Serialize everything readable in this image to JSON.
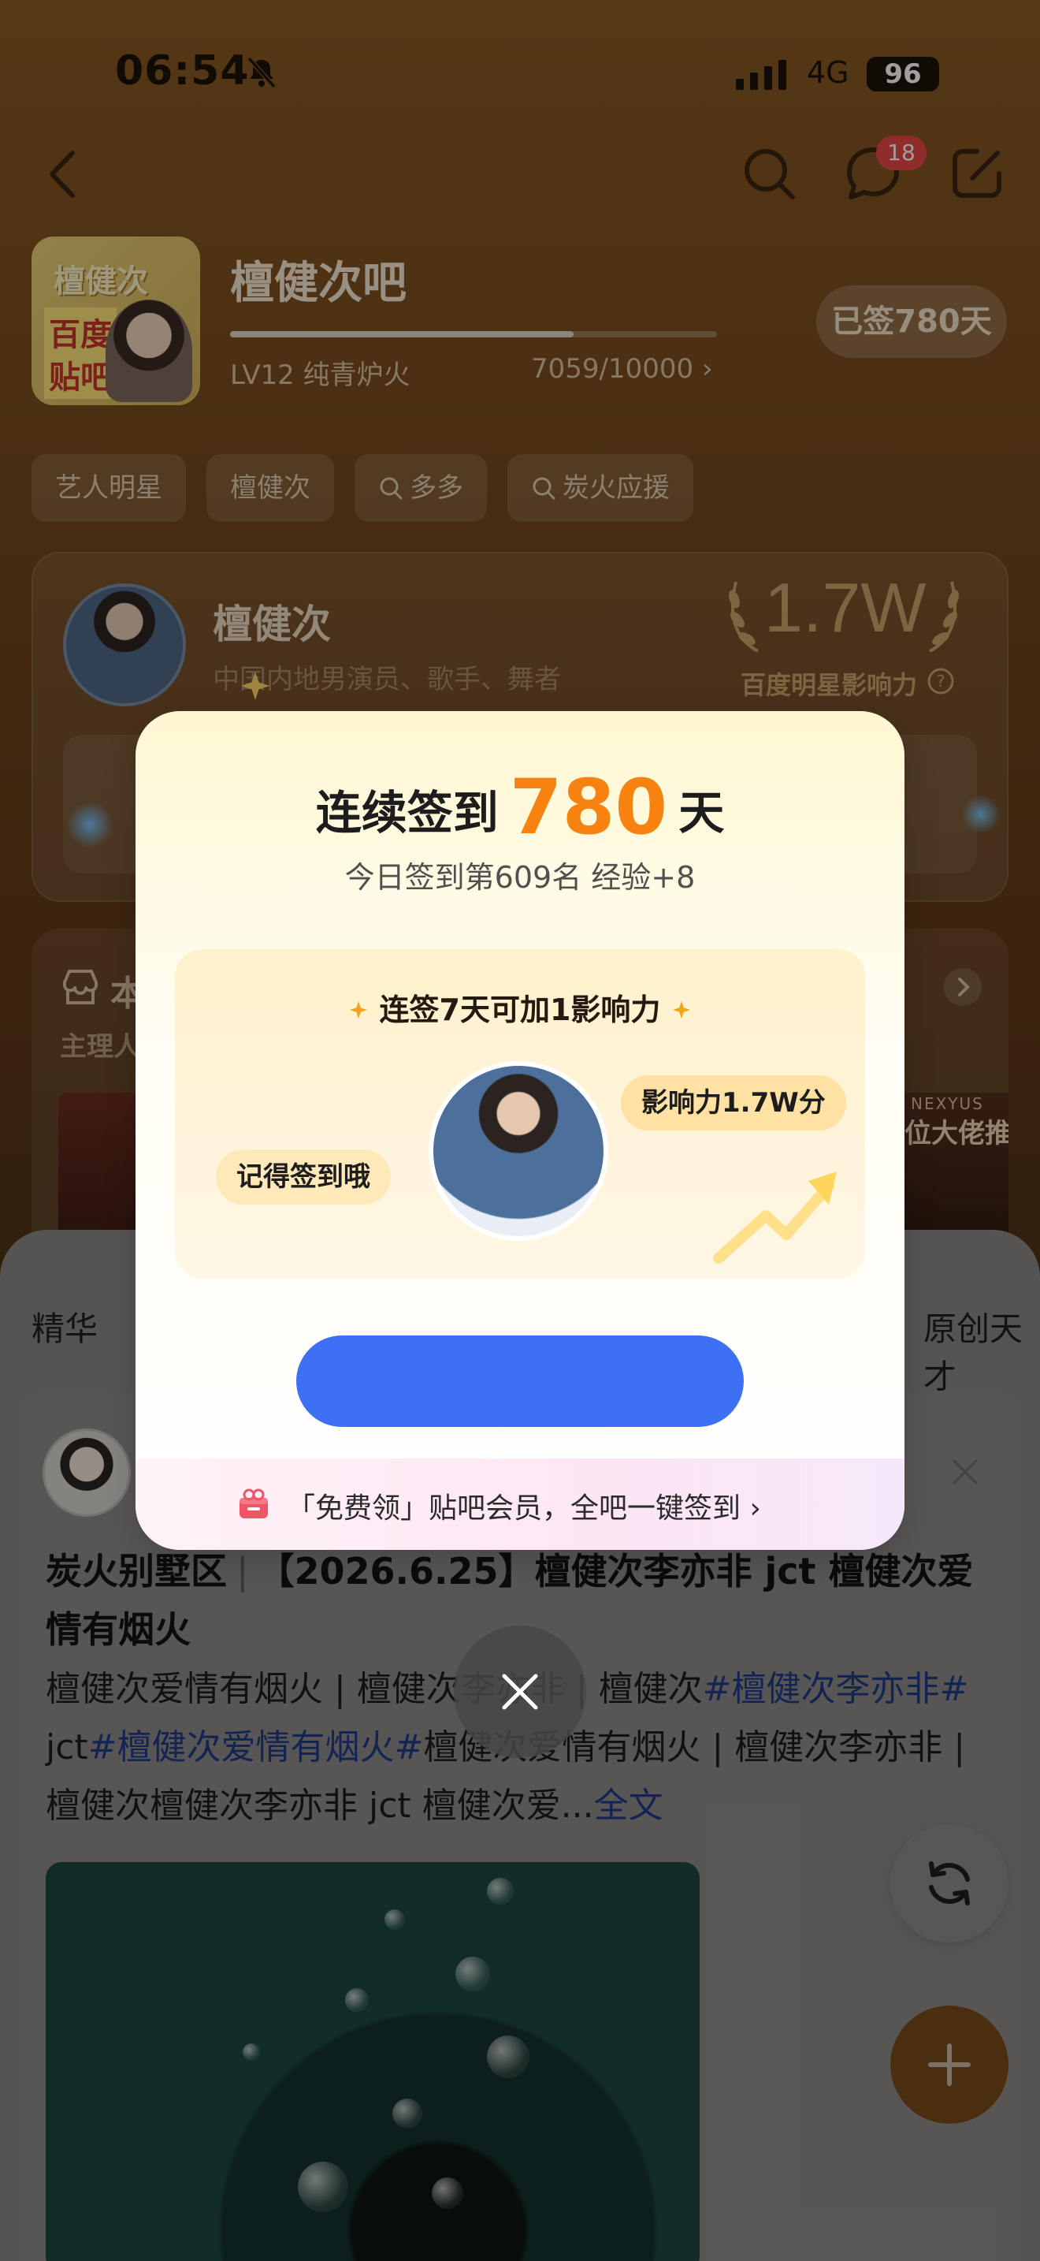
{
  "status": {
    "time": "06:54",
    "network": "4G",
    "battery": "96"
  },
  "nav": {
    "badge_count": "18"
  },
  "forum": {
    "name": "檀健次吧",
    "level": "LV12 纯青炉火",
    "exp": "7059/10000",
    "exp_fraction": 0.7059,
    "signed_days_label": "已签780天",
    "avatar_text": [
      "檀健次",
      "百度",
      "贴吧"
    ]
  },
  "chips": [
    {
      "label": "艺人明星",
      "has_search_icon": false
    },
    {
      "label": "檀健次",
      "has_search_icon": false
    },
    {
      "label": "多多",
      "has_search_icon": true
    },
    {
      "label": "炭火应援",
      "has_search_icon": true
    }
  ],
  "star": {
    "name": "檀健次",
    "description": "中国内地男演员、歌手、舞者",
    "influence": "1.7W",
    "influence_label": "百度明星影响力"
  },
  "section": {
    "title_fragment": "本",
    "sub_fragment": "主理人",
    "right_brand": "NEXYUS",
    "right_text": "位大佬推"
  },
  "tabs": {
    "left": "精华",
    "right": "原创天才"
  },
  "post": {
    "category": "炭火别墅区",
    "title": "【2026.6.25】檀健次李亦非 jct 檀健次爱情有烟火",
    "body_segments": [
      {
        "text": "檀健次爱情有烟火 | 檀健次李亦非 | 檀健次",
        "tag": false
      },
      {
        "text": "#檀健次李亦非#",
        "tag": true
      },
      {
        "text": " jct",
        "tag": false
      },
      {
        "text": "#檀健次爱情有烟火#",
        "tag": true
      },
      {
        "text": "檀健次爱情有烟火 | 檀健次李亦非 | 檀健次檀健次李亦非 jct 檀健次爱...",
        "tag": false
      }
    ],
    "more_label": "全文"
  },
  "modal": {
    "title_prefix": "连续签到",
    "days": "780",
    "title_suffix": "天",
    "subtitle": "今日签到第609名 经验+8",
    "inner_title": "连签7天可加1影响力",
    "bubble_left": "记得签到哦",
    "bubble_right": "影响力1.7W分",
    "button_label": "",
    "footer_text": "「免费领」贴吧会员，全吧一键签到 ›"
  },
  "colors": {
    "accent_orange": "#f7820f",
    "button_blue": "#3d70f5",
    "tag_blue": "#1f3a86",
    "badge_red": "#e84848"
  },
  "icons": [
    "bell-slash-icon",
    "signal-icon",
    "back-icon",
    "search-icon",
    "message-icon",
    "edit-icon",
    "help-icon",
    "store-icon",
    "chevron-right-icon",
    "close-icon",
    "refresh-icon",
    "plus-icon",
    "gift-icon",
    "sparkle-icon",
    "trend-arrow-icon",
    "laurel-icon"
  ]
}
